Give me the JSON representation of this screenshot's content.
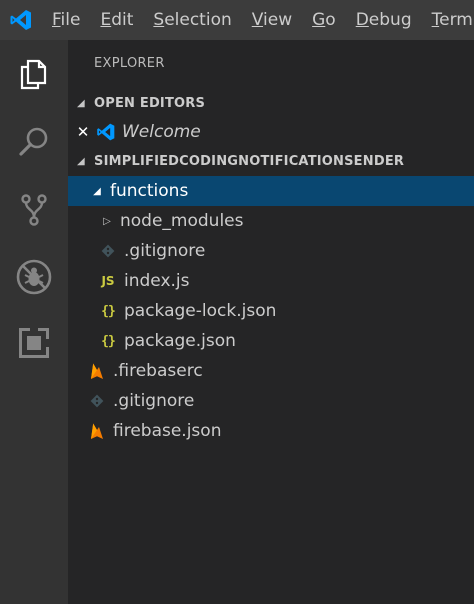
{
  "menu": {
    "items": [
      {
        "label": "File",
        "mnemonic": "F",
        "rest": "ile"
      },
      {
        "label": "Edit",
        "mnemonic": "E",
        "rest": "dit"
      },
      {
        "label": "Selection",
        "mnemonic": "S",
        "rest": "election"
      },
      {
        "label": "View",
        "mnemonic": "V",
        "rest": "iew"
      },
      {
        "label": "Go",
        "mnemonic": "G",
        "rest": "o"
      },
      {
        "label": "Debug",
        "mnemonic": "D",
        "rest": "ebug"
      },
      {
        "label": "Termi",
        "mnemonic": "T",
        "rest": "ermi"
      }
    ]
  },
  "sidebar": {
    "title": "EXPLORER",
    "open_editors": {
      "header": "OPEN EDITORS",
      "items": [
        {
          "label": "Welcome",
          "icon": "vscode-icon"
        }
      ]
    },
    "project": {
      "header": "SIMPLIFIEDCODINGNOTIFICATIONSENDER",
      "items": [
        {
          "label": "functions",
          "icon": "folder-open",
          "selected": true
        },
        {
          "label": "node_modules",
          "icon": "folder-closed"
        },
        {
          "label": ".gitignore",
          "icon": "git-icon"
        },
        {
          "label": "index.js",
          "icon": "js-icon",
          "badge": "JS"
        },
        {
          "label": "package-lock.json",
          "icon": "json-icon",
          "badge": "{}"
        },
        {
          "label": "package.json",
          "icon": "json-icon",
          "badge": "{}"
        },
        {
          "label": ".firebaserc",
          "icon": "firebase-icon"
        },
        {
          "label": ".gitignore",
          "icon": "git-icon"
        },
        {
          "label": "firebase.json",
          "icon": "firebase-icon"
        }
      ]
    }
  },
  "colors": {
    "titlebar": "#3c3c3c",
    "activitybar": "#333333",
    "sidebar": "#252526",
    "selection": "#094771",
    "accent": "#0098ff",
    "firebase": "#f57c00",
    "json": "#cbcb41"
  }
}
